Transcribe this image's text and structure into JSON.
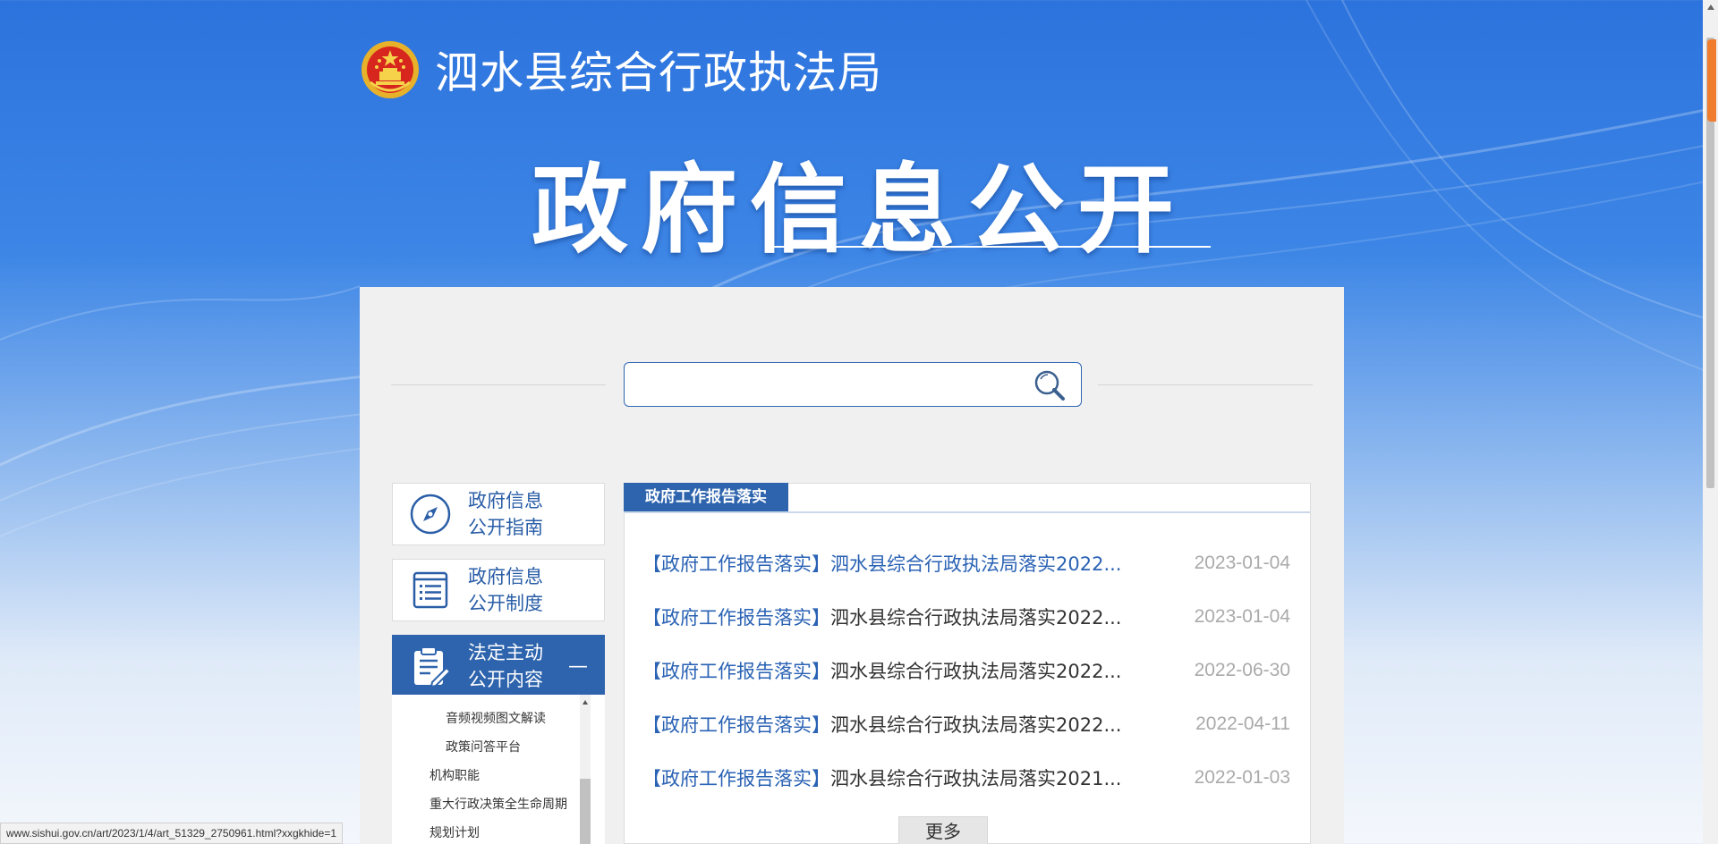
{
  "header": {
    "site_name": "泗水县综合行政执法局",
    "hero_title": "政府信息公开"
  },
  "search": {
    "placeholder": "",
    "value": ""
  },
  "sidebar": {
    "items": [
      {
        "line1": "政府信息",
        "line2": "公开指南",
        "icon": "compass-icon"
      },
      {
        "line1": "政府信息",
        "line2": "公开制度",
        "icon": "list-document-icon"
      },
      {
        "line1": "法定主动",
        "line2": "公开内容",
        "icon": "clipboard-edit-icon",
        "active": true,
        "collapse_symbol": "—"
      }
    ],
    "submenu": [
      {
        "label": "音频视频图文解读"
      },
      {
        "label": "政策问答平台"
      },
      {
        "label": "机构职能"
      },
      {
        "label": "重大行政决策全生命周期"
      },
      {
        "label": "规划计划"
      }
    ]
  },
  "news": {
    "tab_label": "政府工作报告落实",
    "items": [
      {
        "tag": "【政府工作报告落实】",
        "title": "泗水县综合行政执法局落实2022...",
        "date": "2023-01-04"
      },
      {
        "tag": "【政府工作报告落实】",
        "title": "泗水县综合行政执法局落实2022...",
        "date": "2023-01-04"
      },
      {
        "tag": "【政府工作报告落实】",
        "title": "泗水县综合行政执法局落实2022...",
        "date": "2022-06-30"
      },
      {
        "tag": "【政府工作报告落实】",
        "title": "泗水县综合行政执法局落实2022...",
        "date": "2022-04-11"
      },
      {
        "tag": "【政府工作报告落实】",
        "title": "泗水县综合行政执法局落实2021...",
        "date": "2022-01-03"
      }
    ],
    "more_label": "更多"
  },
  "status_bar": {
    "url": "www.sishui.gov.cn/art/2023/1/4/art_51329_2750961.html?xxgkhide=1"
  },
  "colors": {
    "primary": "#2e64ad",
    "link": "#2a62b4",
    "date": "#aaaaaa",
    "accent_orange": "#f07c2e"
  }
}
